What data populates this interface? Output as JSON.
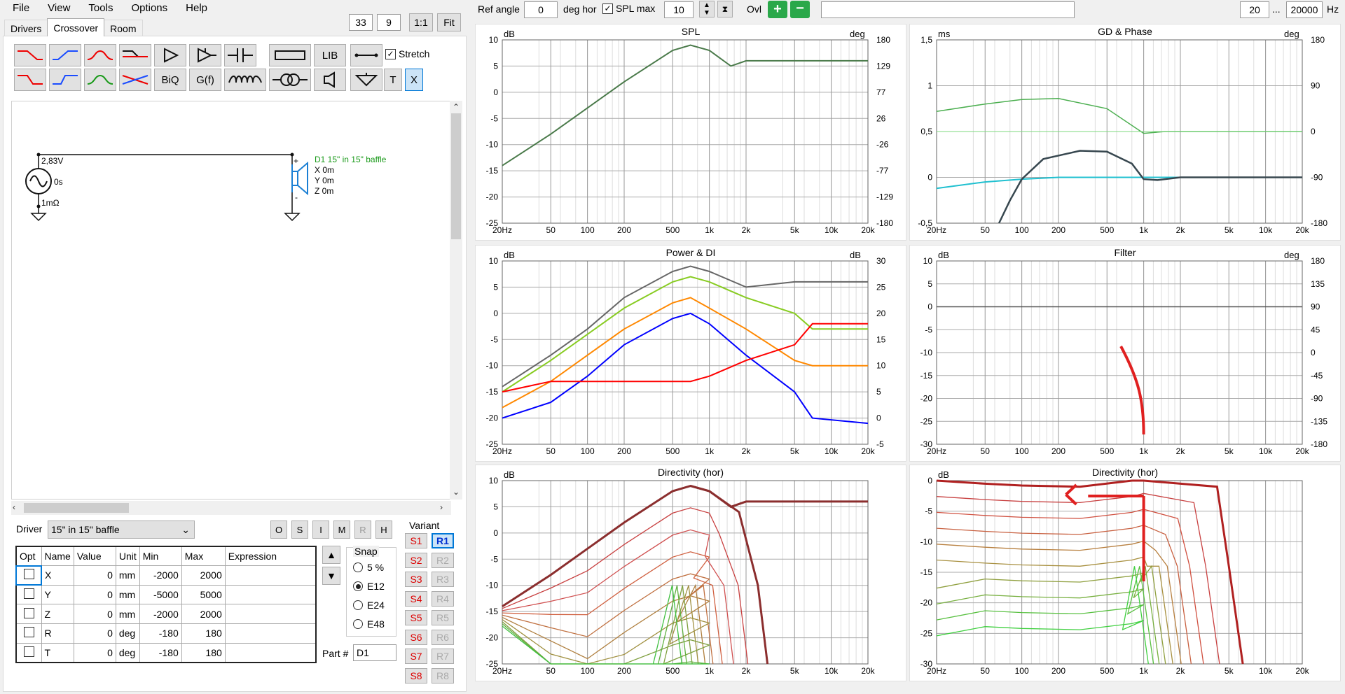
{
  "menu": [
    "File",
    "View",
    "Tools",
    "Options",
    "Help"
  ],
  "toolbar_left": {
    "zoom_a": "33",
    "zoom_b": "9",
    "one_to_one": "1:1",
    "fit": "Fit"
  },
  "tabs": [
    "Drivers",
    "Crossover",
    "Room"
  ],
  "icon_buttons_row1": [
    "lowpass-red-icon",
    "highpass-blue-icon",
    "bandpass-red-icon",
    "shelf-icon",
    "amplifier-icon",
    "buffer-icon",
    "capacitor-icon",
    "resistor-icon",
    "LIB",
    "wire-icon"
  ],
  "icon_buttons_row2": [
    "lowpass-red2-icon",
    "highpass-blue2-icon",
    "bandpass-green-icon",
    "allpass-icon",
    "BiQ",
    "G(f)",
    "inductor-icon",
    "transformer-icon",
    "speaker-icon",
    "ground-icon",
    "T",
    "X"
  ],
  "stretch_label": "Stretch",
  "schematic": {
    "voltage": "2,83V",
    "delay": "0s",
    "impedance": "1mΩ",
    "driver_name": "D1 15\" in 15\" baffle",
    "x": "X 0m",
    "y": "Y 0m",
    "z": "Z 0m",
    "plus": "+",
    "minus": "-"
  },
  "driver_label": "Driver",
  "driver_value": "15\" in 15\" baffle",
  "side_buttons": [
    "O",
    "S",
    "I",
    "M",
    "R",
    "H"
  ],
  "table": {
    "headers": [
      "Opt",
      "Name",
      "Value",
      "Unit",
      "Min",
      "Max",
      "Expression"
    ],
    "rows": [
      [
        "X",
        "0",
        "mm",
        "-2000",
        "2000"
      ],
      [
        "Y",
        "0",
        "mm",
        "-5000",
        "5000"
      ],
      [
        "Z",
        "0",
        "mm",
        "-2000",
        "2000"
      ],
      [
        "R",
        "0",
        "deg",
        "-180",
        "180"
      ],
      [
        "T",
        "0",
        "deg",
        "-180",
        "180"
      ]
    ]
  },
  "snap": {
    "label": "Snap",
    "options": [
      "5 %",
      "E12",
      "E24",
      "E48"
    ],
    "selected": "E12"
  },
  "part_label": "Part #",
  "part_value": "D1",
  "variant": {
    "label": "Variant",
    "s": [
      "S1",
      "S2",
      "S3",
      "S4",
      "S5",
      "S6",
      "S7",
      "S8"
    ],
    "r": [
      "R1",
      "R2",
      "R3",
      "R4",
      "R5",
      "R6",
      "R7",
      "R8"
    ]
  },
  "topbar": {
    "ref_angle_label": "Ref angle",
    "ref_angle": "0",
    "deg_hor": "deg hor",
    "spl_max_label": "SPL max",
    "spl_max": "10",
    "ovl": "Ovl",
    "f_min": "20",
    "ellipsis": "...",
    "f_max": "20000",
    "hz": "Hz"
  },
  "x_ticks": [
    "20Hz",
    "50",
    "100",
    "200",
    "500",
    "1k",
    "2k",
    "5k",
    "10k",
    "20k"
  ],
  "graphs": [
    {
      "title": "SPL",
      "unit_l": "dB",
      "unit_r": "deg",
      "yl": [
        "10",
        "5",
        "0",
        "-5",
        "-10",
        "-15",
        "-20",
        "-25"
      ],
      "yr": [
        "180",
        "129",
        "77",
        "26",
        "-26",
        "-77",
        "-129",
        "-180"
      ]
    },
    {
      "title": "GD & Phase",
      "unit_l": "ms",
      "unit_r": "deg",
      "yl": [
        "1,5",
        "1",
        "0,5",
        "0",
        "-0,5"
      ],
      "yr": [
        "180",
        "90",
        "0",
        "-90",
        "-180"
      ]
    },
    {
      "title": "Power & DI",
      "unit_l": "dB",
      "unit_r": "dB",
      "yl": [
        "10",
        "5",
        "0",
        "-5",
        "-10",
        "-15",
        "-20",
        "-25"
      ],
      "yr": [
        "30",
        "25",
        "20",
        "15",
        "10",
        "5",
        "0",
        "-5"
      ]
    },
    {
      "title": "Filter",
      "unit_l": "dB",
      "unit_r": "deg",
      "yl": [
        "10",
        "5",
        "0",
        "-5",
        "-10",
        "-15",
        "-20",
        "-25",
        "-30"
      ],
      "yr": [
        "180",
        "135",
        "90",
        "45",
        "0",
        "-45",
        "-90",
        "-135",
        "-180"
      ]
    },
    {
      "title": "Directivity (hor)",
      "unit_l": "dB",
      "unit_r": "",
      "yl": [
        "10",
        "5",
        "0",
        "-5",
        "-10",
        "-15",
        "-20",
        "-25"
      ],
      "yr": []
    },
    {
      "title": "Directivity (hor)",
      "unit_l": "dB",
      "unit_r": "",
      "yl": [
        "0",
        "-5",
        "-10",
        "-15",
        "-20",
        "-25",
        "-30"
      ],
      "yr": []
    }
  ],
  "chart_data": [
    {
      "type": "line",
      "title": "SPL",
      "xlabel": "",
      "ylabel": "dB",
      "x": [
        20,
        50,
        100,
        200,
        500,
        700,
        1000,
        1500,
        2000,
        5000,
        20000
      ],
      "ylim": [
        -25,
        10
      ],
      "series": [
        {
          "values": [
            -14,
            -8,
            -3,
            2,
            8,
            9,
            8,
            5,
            6,
            6,
            6
          ],
          "color": "#4a7a4a"
        }
      ]
    },
    {
      "type": "line",
      "title": "Power & DI",
      "ylabel": "dB",
      "ylim": [
        -25,
        10
      ],
      "x": [
        20,
        50,
        100,
        200,
        500,
        700,
        1000,
        2000,
        5000,
        7000,
        20000
      ],
      "series": [
        {
          "values": [
            -14,
            -8,
            -3,
            3,
            8,
            9,
            8,
            5,
            6,
            6,
            6
          ],
          "color": "#666666"
        },
        {
          "values": [
            -15,
            -9,
            -4,
            1,
            6,
            7,
            6,
            3,
            0,
            -3,
            -3
          ],
          "color": "#88cc22"
        },
        {
          "values": [
            -18,
            -13,
            -8,
            -3,
            2,
            3,
            1,
            -3,
            -9,
            -10,
            -10
          ],
          "color": "#ff8800"
        },
        {
          "values": [
            -20,
            -17,
            -12,
            -6,
            -1,
            0,
            -2,
            -8,
            -15,
            -20,
            -21
          ],
          "color": "#0000ff"
        },
        {
          "values": [
            -15,
            -13,
            -13,
            -13,
            -13,
            -13,
            -12,
            -9,
            -6,
            -2,
            -2
          ],
          "color": "#ff0000"
        }
      ]
    }
  ]
}
